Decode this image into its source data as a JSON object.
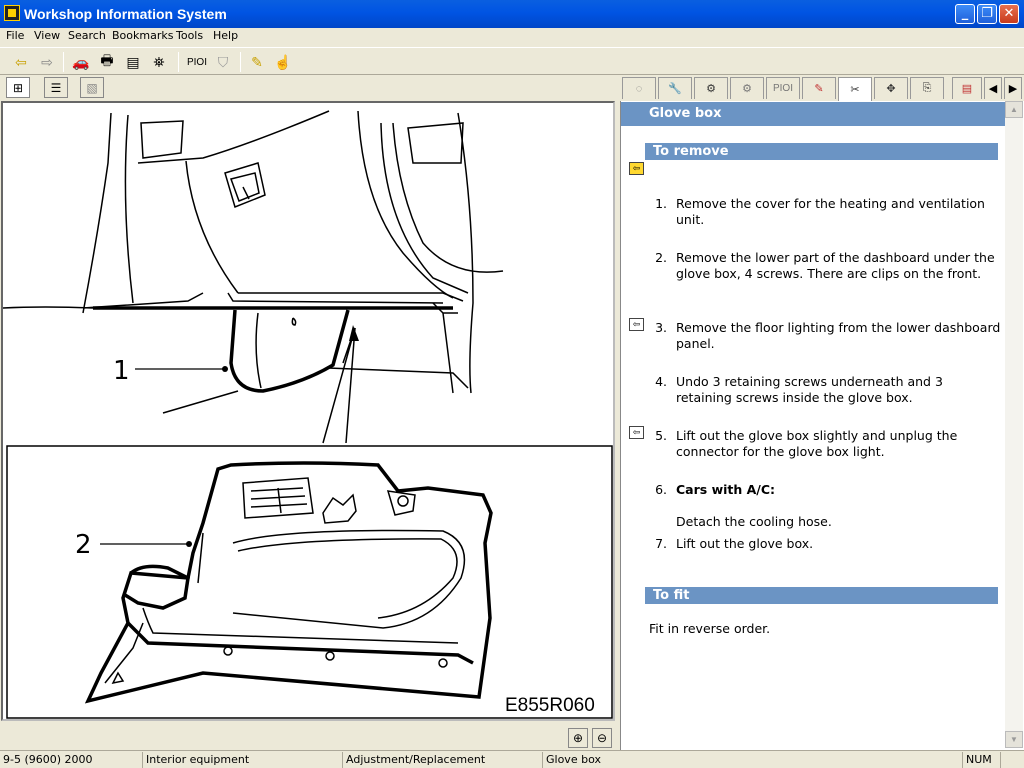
{
  "window": {
    "title": "Workshop Information System"
  },
  "menu": [
    "File",
    "View",
    "Search",
    "Bookmarks",
    "Tools",
    "Help"
  ],
  "toolbar": {
    "pio_label": "PIOI"
  },
  "right_tabs": {
    "pio_label": "PIOI"
  },
  "figure": {
    "label_1": "1",
    "label_2": "2",
    "image_code": "E855R060"
  },
  "doc": {
    "title": "Glove box",
    "remove_heading": "To remove",
    "steps": [
      {
        "n": "1.",
        "text": "Remove the cover for the heating and ventilation unit."
      },
      {
        "n": "2.",
        "text": "Remove the lower part of the dashboard under the glove box, 4 screws. There are clips on the front."
      },
      {
        "n": "3.",
        "text": "Remove the floor lighting from the lower dashboard panel."
      },
      {
        "n": "4.",
        "text": "Undo 3 retaining screws underneath and 3 retaining screws inside the glove box."
      },
      {
        "n": "5.",
        "text": "Lift out the glove box slightly and unplug the connector for the glove box light."
      },
      {
        "n": "6.",
        "text": "Cars with A/C:",
        "sub": "Detach the cooling hose."
      },
      {
        "n": "7.",
        "text": "Lift out the glove box."
      }
    ],
    "fit_heading": "To fit",
    "fit_text": "Fit in reverse order."
  },
  "status": {
    "model": "9-5 (9600) 2000",
    "group": "Interior equipment",
    "type": "Adjustment/Replacement",
    "item": "Glove box",
    "num": "NUM"
  },
  "colors": {
    "header_blue": "#6B94C4",
    "title_blue": "#0054E3"
  }
}
